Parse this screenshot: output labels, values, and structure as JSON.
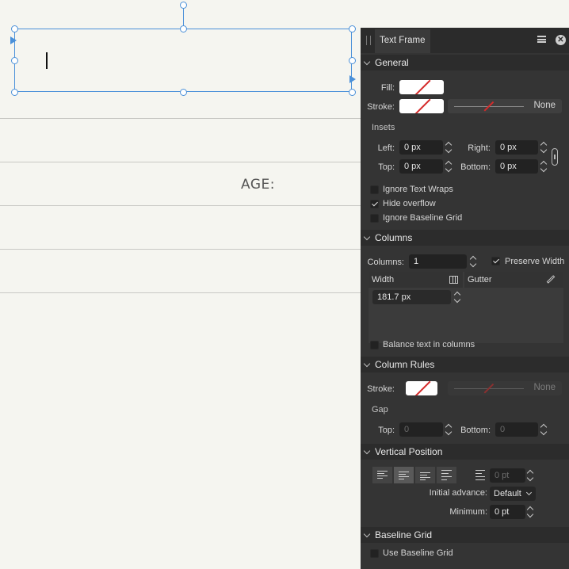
{
  "canvas": {
    "age_label": "AGE:"
  },
  "panel": {
    "tab_title": "Text Frame",
    "general": {
      "title": "General",
      "fill_label": "Fill:",
      "stroke_label": "Stroke:",
      "stroke_value": "None",
      "insets_label": "Insets",
      "left_label": "Left:",
      "left_value": "0 px",
      "right_label": "Right:",
      "right_value": "0 px",
      "top_label": "Top:",
      "top_value": "0 px",
      "bottom_label": "Bottom:",
      "bottom_value": "0 px",
      "ignore_text_wraps": "Ignore Text Wraps",
      "hide_overflow": "Hide overflow",
      "ignore_baseline_grid": "Ignore Baseline Grid",
      "ignore_text_wraps_checked": false,
      "hide_overflow_checked": true,
      "ignore_baseline_grid_checked": false
    },
    "columns": {
      "title": "Columns",
      "columns_label": "Columns:",
      "columns_value": "1",
      "preserve_width": "Preserve Width",
      "preserve_width_checked": true,
      "width_header": "Width",
      "gutter_header": "Gutter",
      "width_value": "181.7 px",
      "balance_text": "Balance text in columns",
      "balance_text_checked": false
    },
    "column_rules": {
      "title": "Column Rules",
      "stroke_label": "Stroke:",
      "stroke_value": "None",
      "gap_label": "Gap",
      "top_label": "Top:",
      "top_value": "0",
      "bottom_label": "Bottom:",
      "bottom_value": "0"
    },
    "vertical_position": {
      "title": "Vertical Position",
      "spacing_value": "0 pt",
      "initial_advance_label": "Initial advance:",
      "initial_advance_value": "Default",
      "minimum_label": "Minimum:",
      "minimum_value": "0 pt"
    },
    "baseline_grid": {
      "title": "Baseline Grid",
      "use_baseline_grid": "Use Baseline Grid",
      "use_baseline_grid_checked": false
    }
  },
  "colors": {
    "selection_blue": "#4a90d9",
    "panel_bg": "#343434",
    "none_slash_red": "#d42a2a"
  }
}
